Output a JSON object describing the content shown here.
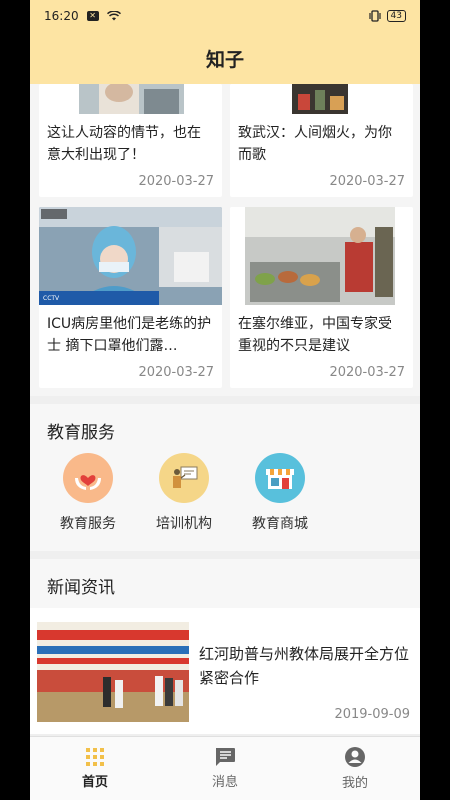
{
  "status_bar": {
    "time": "16:20",
    "battery": "43"
  },
  "header": {
    "title": "知子"
  },
  "articles": [
    {
      "title": "这让人动容的情节，也在意大利出现了！",
      "date": "2020-03-27"
    },
    {
      "title": "致武汉：人间烟火，为你而歌",
      "date": "2020-03-27"
    },
    {
      "title": "ICU病房里他们是老练的护士 摘下口罩他们露…",
      "date": "2020-03-27"
    },
    {
      "title": "在塞尔维亚，中国专家受重视的不只是建议",
      "date": "2020-03-27"
    }
  ],
  "education": {
    "title": "教育服务",
    "items": [
      {
        "label": "教育服务",
        "icon": "hands-heart-icon"
      },
      {
        "label": "培训机构",
        "icon": "teacher-board-icon"
      },
      {
        "label": "教育商城",
        "icon": "store-icon"
      }
    ]
  },
  "news": {
    "title": "新闻资讯",
    "items": [
      {
        "title": "红河助普与州教体局展开全方位紧密合作",
        "date": "2019-09-09"
      }
    ]
  },
  "tabbar": [
    {
      "label": "首页",
      "icon": "grid-icon",
      "active": true
    },
    {
      "label": "消息",
      "icon": "message-icon",
      "active": false
    },
    {
      "label": "我的",
      "icon": "profile-icon",
      "active": false
    }
  ],
  "colors": {
    "header": "#fde4a3",
    "accent": "#f5c842"
  }
}
